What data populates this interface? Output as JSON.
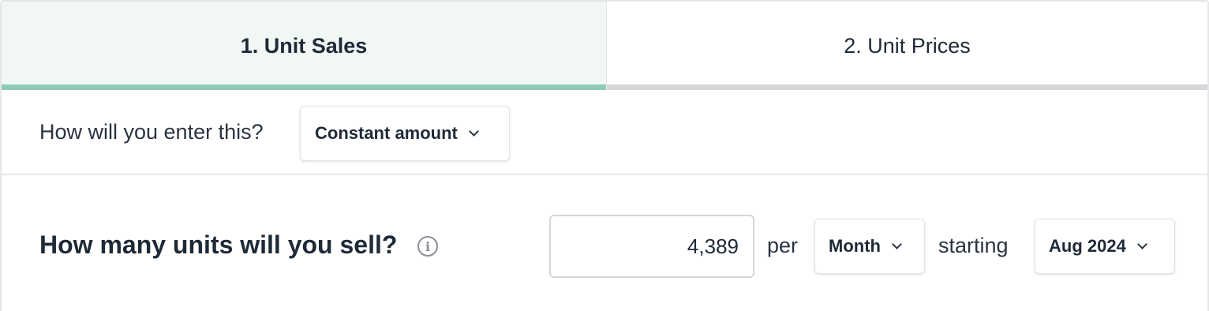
{
  "tabs": [
    {
      "label": "1. Unit Sales",
      "active": true
    },
    {
      "label": "2. Unit Prices",
      "active": false
    }
  ],
  "colors": {
    "active_tab_bg": "#f1f7f5",
    "active_tab_underline": "#8fcbb9",
    "inactive_tab_underline": "#d6d7db",
    "text": "#1f2a37"
  },
  "entry": {
    "label": "How will you enter this?",
    "method_selected": "Constant amount"
  },
  "question": {
    "label": "How many units will you sell?",
    "info_icon": "info-circle-icon",
    "units_value": "4,389",
    "per_label": "per",
    "period_selected": "Month",
    "starting_label": "starting",
    "start_date_selected": "Aug 2024"
  }
}
